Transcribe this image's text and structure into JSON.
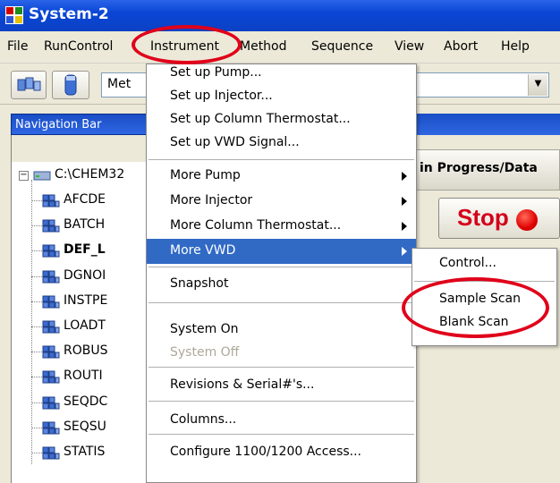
{
  "window": {
    "title": "System-2"
  },
  "menubar": {
    "items": [
      {
        "key": "file",
        "label": "File"
      },
      {
        "key": "runcontrol",
        "label": "RunControl"
      },
      {
        "key": "instrument",
        "label": "Instrument"
      },
      {
        "key": "method",
        "label": "Method"
      },
      {
        "key": "sequence",
        "label": "Sequence"
      },
      {
        "key": "view",
        "label": "View"
      },
      {
        "key": "abort",
        "label": "Abort"
      },
      {
        "key": "help",
        "label": "Help"
      }
    ]
  },
  "toolbar": {
    "combo_left_value": "Met",
    "combo_right_value": ""
  },
  "navigation": {
    "title": "Navigation Bar",
    "root": "C:\\CHEM32",
    "items": [
      "AFCDE",
      "BATCH",
      "DEF_L",
      "DGNOI",
      "INSTPE",
      "LOADT",
      "ROBUS",
      "ROUTI",
      "SEQDC",
      "SEQSU",
      "STATIS"
    ],
    "bold_item": "DEF_L"
  },
  "right_panel": {
    "status_header": "in Progress/Data",
    "stop_label": "Stop"
  },
  "instrument_menu": {
    "items": [
      {
        "label": "Set up Pump...",
        "submenu": false
      },
      {
        "label": "Set up Injector...",
        "submenu": false
      },
      {
        "label": "Set up Column Thermostat...",
        "submenu": false
      },
      {
        "label": "Set up VWD Signal...",
        "submenu": false
      },
      {
        "label": "More Pump",
        "submenu": true
      },
      {
        "label": "More Injector",
        "submenu": true
      },
      {
        "label": "More Column Thermostat...",
        "submenu": true
      },
      {
        "label": "More VWD",
        "submenu": true,
        "highlighted": true
      },
      {
        "label": "Snapshot",
        "submenu": false
      },
      {
        "label": "System On",
        "submenu": false
      },
      {
        "label": "System Off",
        "submenu": false,
        "disabled": true
      },
      {
        "label": "Revisions & Serial#'s...",
        "submenu": false
      },
      {
        "label": "Columns...",
        "submenu": false
      },
      {
        "label": "Configure 1100/1200 Access...",
        "submenu": false
      }
    ]
  },
  "vwd_submenu": {
    "items": [
      {
        "label": "Control..."
      },
      {
        "label": "Sample Scan"
      },
      {
        "label": "Blank Scan"
      }
    ]
  },
  "colors": {
    "title_bar": "#0b41c4",
    "menu_highlight": "#316ac5",
    "annotation_red": "#e0001a",
    "stop_red": "#d4001a"
  }
}
